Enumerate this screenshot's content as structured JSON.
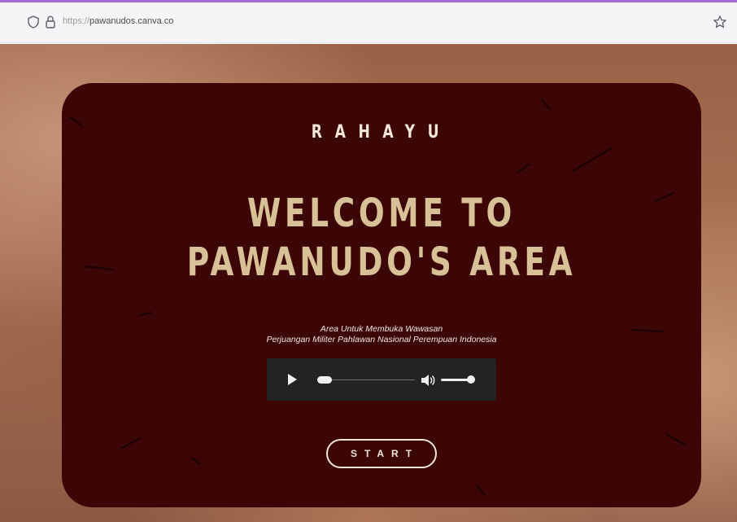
{
  "browser": {
    "url_scheme": "https://",
    "url_host": "pawanudos.canva.co",
    "icons": {
      "tracking": "shield-icon",
      "security": "lock-icon",
      "bookmark": "star-icon"
    },
    "accent_color": "#a66ad8"
  },
  "page": {
    "brand": "RAHAYU",
    "headline_line1": "WELCOME TO",
    "headline_line2": "PAWANUDO'S AREA",
    "tagline_line1": "Area Untuk Membuka Wawasan",
    "tagline_line2": "Perjuangan Militer Pahlawan Nasional Perempuan Indonesia",
    "start_label": "START",
    "colors": {
      "card": "#3c0607",
      "headline": "#d8c197",
      "brand": "#f4e7d3"
    }
  },
  "audio_player": {
    "controls": [
      "play-icon",
      "volume-icon"
    ]
  }
}
